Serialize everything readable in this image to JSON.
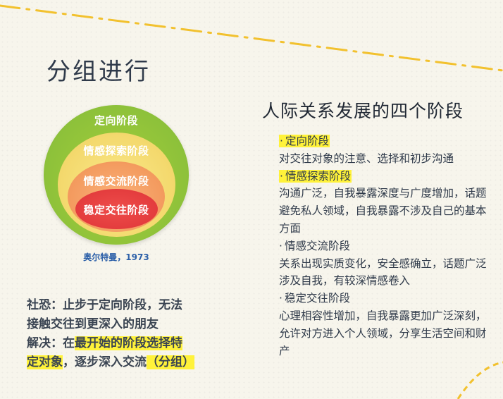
{
  "title": "分组进行",
  "right_title": "人际关系发展的四个阶段",
  "diagram": {
    "layers": [
      "定向阶段",
      "情感探索阶段",
      "情感交流阶段",
      "稳定交往阶段"
    ],
    "colors": [
      "#8dc13a",
      "#f3d86c",
      "#f39a5e",
      "#e23a3c"
    ],
    "citation": "奥尔特曼，1973"
  },
  "stages": [
    {
      "marker": "·",
      "name": "定向阶段",
      "highlight": true,
      "desc": "对交往对象的注意、选择和初步沟通"
    },
    {
      "marker": "·",
      "name": "情感探索阶段",
      "highlight": true,
      "desc": "沟通广泛，自我暴露深度与广度增加，话题避免私人领域，自我暴露不涉及自己的基本方面"
    },
    {
      "marker": "·",
      "name": "情感交流阶段",
      "highlight": false,
      "desc": "关系出现实质变化，安全感确立，话题广泛涉及自我，有较深情感卷入"
    },
    {
      "marker": "·",
      "name": "稳定交往阶段",
      "highlight": false,
      "desc": "心理相容性增加，自我暴露更加广泛深刻，允许对方进入个人领域，分享生活空间和财产"
    }
  ],
  "note": {
    "line1": "社恐：止步于定向阶段，无法",
    "line2": "接触交往到更深入的朋友",
    "line3_prefix": "解决：在",
    "line3_hl": "最开始的阶段选择特",
    "line4_hl": "定对象",
    "line4_mid": "，逐步深入交流",
    "line4_hl2": "（分组）"
  },
  "highlight_color": "#fff23a",
  "accent_dash_color": "#f2c12e"
}
